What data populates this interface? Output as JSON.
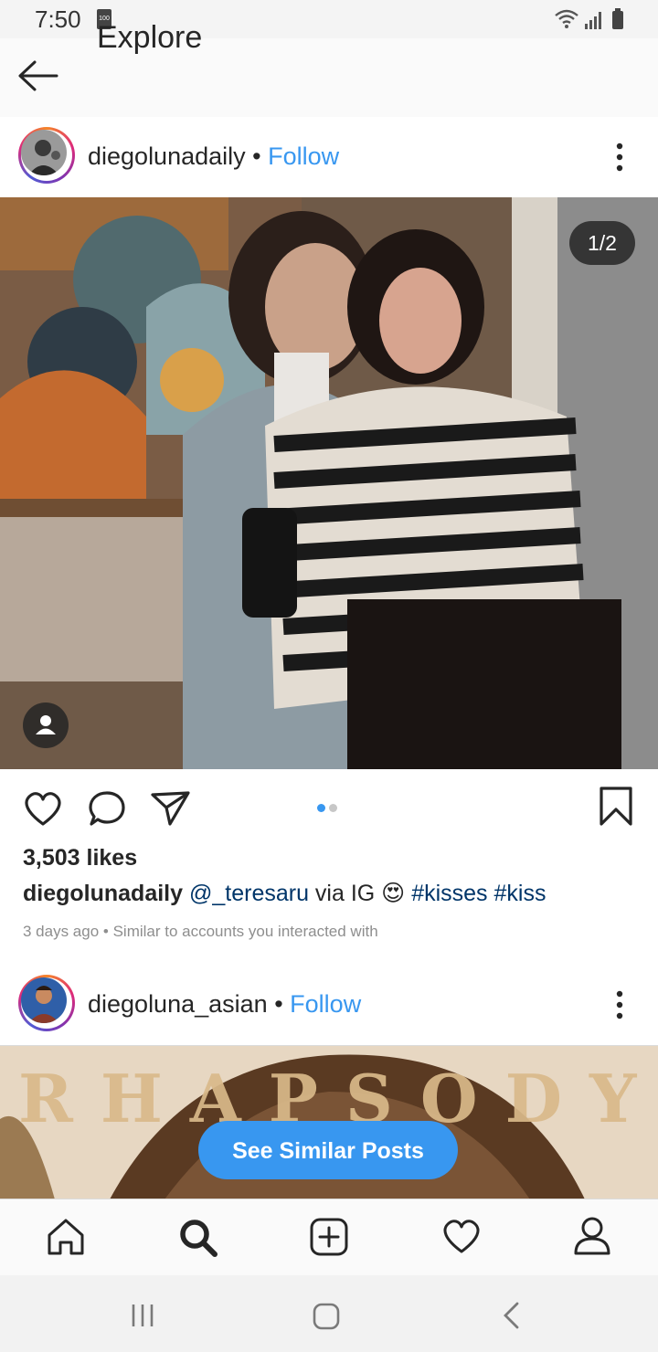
{
  "status_bar": {
    "time": "7:50",
    "battery_label": "100"
  },
  "header": {
    "title": "Explore"
  },
  "posts": [
    {
      "username": "diegolunadaily",
      "separator": "•",
      "follow_label": "Follow",
      "image_counter": "1/2",
      "likes": "3,503 likes",
      "caption": {
        "username": "diegolunadaily",
        "mention": "@_teresaru",
        "text": " via IG ",
        "emoji": "😍",
        "hashtags": "#kisses #kiss"
      },
      "meta": "3 days ago • Similar to accounts you interacted with"
    },
    {
      "username": "diegoluna_asian",
      "separator": "•",
      "follow_label": "Follow",
      "image_title": "RHAPSODY",
      "see_similar_label": "See Similar Posts"
    }
  ],
  "bottom_nav": [
    "home-icon",
    "search-icon",
    "add-icon",
    "heart-icon",
    "profile-icon"
  ],
  "colors": {
    "accent": "#3897f0",
    "link": "#003569"
  }
}
